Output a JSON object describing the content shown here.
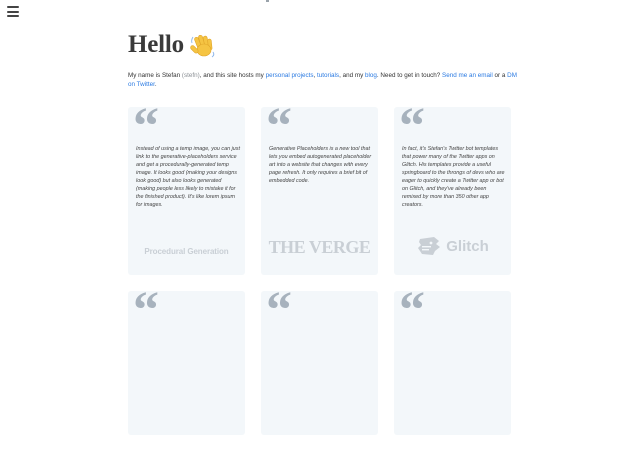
{
  "nav": {
    "menu_icon": "hamburger-menu-icon"
  },
  "header": {
    "title": "Hello",
    "wave_icon": "waving-hand-emoji-icon"
  },
  "intro": {
    "p1": "My name is Stefan ",
    "handle": "(stefn)",
    "p2": ", and this site hosts my ",
    "link_projects": "personal projects",
    "p3": ", ",
    "link_tutorials": "tutorials",
    "p4": ", and my ",
    "link_blog": "blog",
    "p5": ". Need to get in touch? ",
    "link_email": "Send me an email",
    "p6": " or a ",
    "link_dm": "DM on Twitter",
    "p7": "."
  },
  "testimonials": [
    {
      "quote": "Instead of using a temp image, you can just link to the generative-placeholders service and get a procedurally-generated temp image. It looks good (making your designs look good) but also looks generated (making people less likely to mistake it for the finished product). It's like lorem ipsum for images.",
      "source": "Procedural Generation"
    },
    {
      "quote": "Generative Placeholders is a new tool that lets you embed autogenerated placeholder art into a website that changes with every page refresh. It only requires a brief bit of embedded code.",
      "source": "THE VERGE"
    },
    {
      "quote": "In fact, it's Stefan's Twitter bot templates that power many of the Twitter apps on Glitch. His templates provide a useful springboard to the throngs of devs who are eager to quickly create a Twitter app or bot on Glitch, and they've already been remixed by more than 350 other app creators.",
      "source": "Glitch"
    }
  ],
  "colors": {
    "card_bg": "#f3f7fa",
    "quote_mark": "#a7b2bd",
    "link": "#2a7ae2",
    "logo": "#c9cfd5"
  }
}
